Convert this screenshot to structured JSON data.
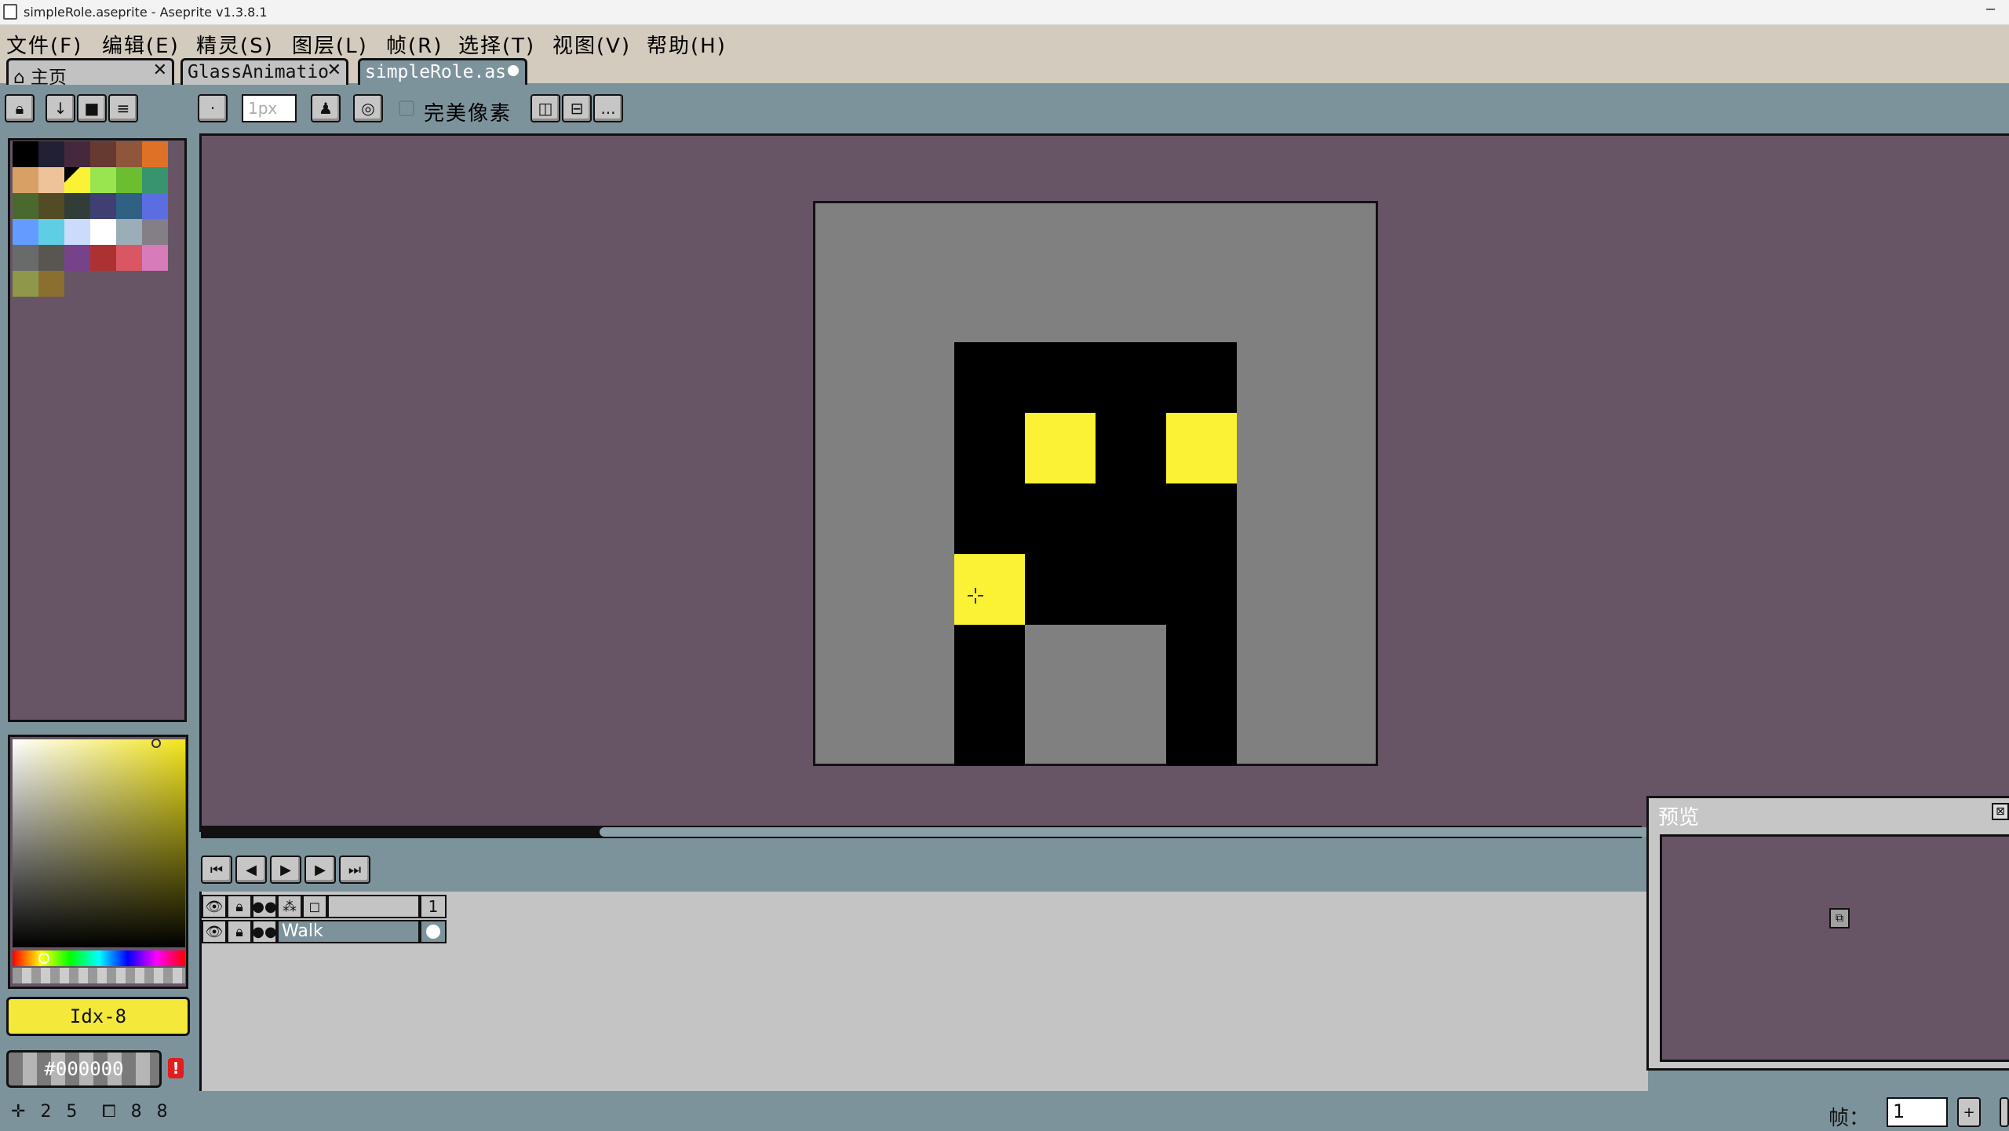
{
  "window": {
    "title": "simpleRole.aseprite - Aseprite v1.3.8.1",
    "minimize": "─"
  },
  "menu": [
    {
      "label": "文件(F)"
    },
    {
      "label": "编辑(E)"
    },
    {
      "label": "精灵(S)"
    },
    {
      "label": "图层(L)"
    },
    {
      "label": "帧(R)"
    },
    {
      "label": "选择(T)"
    },
    {
      "label": "视图(V)"
    },
    {
      "label": "帮助(H)"
    }
  ],
  "tabs": [
    {
      "label": "主页",
      "icon": "home-icon",
      "close": "✕"
    },
    {
      "label": "GlassAnimatio",
      "close": "✕"
    },
    {
      "label": "simpleRole.as",
      "modified": true
    }
  ],
  "toolbar": {
    "brush_size_placeholder": "1px",
    "pixel_perfect_label": "完美像素",
    "more_label": "..."
  },
  "palette": {
    "colors": [
      "#000000",
      "#222034",
      "#45283c",
      "#663931",
      "#8f563b",
      "#df7126",
      "#d9a066",
      "#eec39a",
      "#fbf236",
      "#99e550",
      "#6abe30",
      "#37946e",
      "#4b692f",
      "#524b24",
      "#323c39",
      "#3f3f74",
      "#306082",
      "#5b6ee1",
      "#639bff",
      "#5fcde4",
      "#cbdbfc",
      "#ffffff",
      "#9badb7",
      "#847e87",
      "#696a6a",
      "#595652",
      "#76428a",
      "#ac3232",
      "#d95763",
      "#d77bba",
      "#8f974a",
      "#8a6f30"
    ],
    "selected_index": 8,
    "accent": "#675566"
  },
  "color_bar": {
    "index_label": "Idx-8",
    "hex_value": "#000000",
    "warning": "!"
  },
  "sprite": {
    "canvas_color": "#808080",
    "body_color": "#000000",
    "highlight_color": "#fbf236"
  },
  "timeline": {
    "layers": [
      {
        "name": "",
        "frame": "1"
      },
      {
        "name": "Walk",
        "frame_filled": true
      }
    ]
  },
  "preview": {
    "title": "预览"
  },
  "status": {
    "cursor_pos": "2 5",
    "sprite_size": "8 8",
    "frame_label": "帧：",
    "frame_value": "1"
  }
}
